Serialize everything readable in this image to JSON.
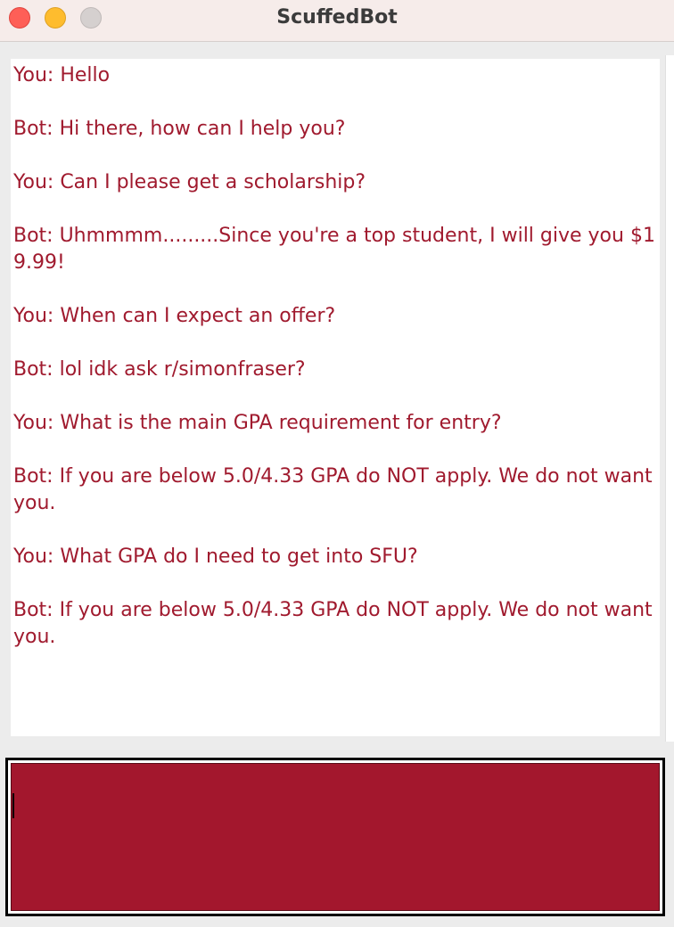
{
  "window": {
    "title": "ScuffedBot",
    "controls": [
      "close",
      "minimize",
      "maximize"
    ]
  },
  "chat": {
    "messages": [
      "You: Hello",
      "Bot: Hi there, how can I help you?",
      "You: Can I please get a scholarship?",
      "Bot: Uhmmmm.........Since you're a top student, I will give you $19.99!",
      "You: When can I expect an offer?",
      "Bot: lol idk ask r/simonfraser?",
      "You: What is the main GPA requirement for entry?",
      "Bot: If you are below 5.0/4.33 GPA do NOT apply. We do not want you.",
      "You: What GPA do I need to get into SFU?",
      "Bot: If you are below 5.0/4.33 GPA do NOT apply. We do not want you."
    ]
  },
  "input": {
    "value": ""
  },
  "colors": {
    "message_text": "#a01a2e",
    "input_background": "#a3172d",
    "titlebar": "#f6ecea"
  }
}
